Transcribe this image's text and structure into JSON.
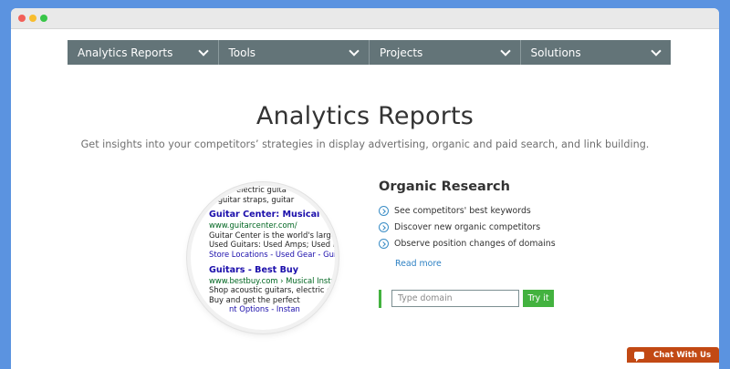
{
  "nav": {
    "items": [
      {
        "label": "Analytics Reports"
      },
      {
        "label": "Tools"
      },
      {
        "label": "Projects"
      },
      {
        "label": "Solutions"
      }
    ]
  },
  "hero": {
    "title": "Analytics Reports",
    "subtitle": "Get insights into your competitors’ strategies in display advertising, organic and paid search, and link building."
  },
  "magnifier": {
    "lines": {
      "top1": "electric guita",
      "top2": "s, guitar straps, guitar",
      "r1_title": "Guitar Center: Musical Instr",
      "r1_url": "www.guitarcenter.com/",
      "r1_desc1": "Guitar Center is the world's largest",
      "r1_desc2": "Used Guitars: Used Amps; Used Bas",
      "r1_links": "Store Locations - Used Gear - Guitars",
      "r2_title": "Guitars - Best Buy",
      "r2_url": "www.bestbuy.com › Musical Instr",
      "r2_desc1": "Shop acoustic guitars, electric gu",
      "r2_desc2": "Buy and get the perfect",
      "r2_links": "nt Options - Instan"
    }
  },
  "organic": {
    "title": "Organic Research",
    "features": [
      "See competitors' best keywords",
      "Discover new organic competitors",
      "Observe position changes of domains"
    ],
    "read_more": "Read more",
    "input_placeholder": "Type domain",
    "button_label": "Try it"
  },
  "chat": {
    "label": "Chat With Us"
  },
  "colors": {
    "background": "#5b93e0",
    "nav": "#637478",
    "accent_green": "#43b23f",
    "link_blue": "#2f82c4",
    "chat_orange": "#c24914"
  }
}
